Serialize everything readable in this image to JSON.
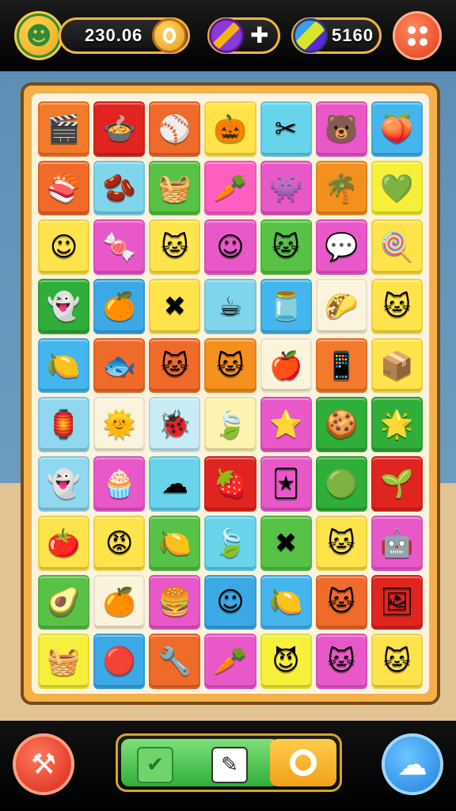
{
  "header": {
    "score": "230.06",
    "gems": "5160",
    "avatar_icon": "sun-face-icon",
    "score_icon": "coin-icon",
    "puzzle_icon": "puzzle-icon",
    "gem_icon": "gem-icon",
    "menu_icon": "dots-grid-icon"
  },
  "board": {
    "rows": [
      [
        {
          "icon": "clapperboard",
          "glyph": "🎬",
          "bg": "#f37a2a"
        },
        {
          "icon": "food-bowl",
          "glyph": "🍲",
          "bg": "#e0241f"
        },
        {
          "icon": "ball",
          "glyph": "⚾",
          "bg": "#f06a2a"
        },
        {
          "icon": "pumpkin",
          "glyph": "🎃",
          "bg": "#ffe34a"
        },
        {
          "icon": "crossed-sticks",
          "glyph": "✂",
          "bg": "#67d4ec"
        },
        {
          "icon": "bear-face",
          "glyph": "🐻",
          "bg": "#e958c8"
        },
        {
          "icon": "heart-fruit",
          "glyph": "🍑",
          "bg": "#45b5ee"
        }
      ],
      [
        {
          "icon": "sushi",
          "glyph": "🍣",
          "bg": "#f06a2a"
        },
        {
          "icon": "bean",
          "glyph": "🫘",
          "bg": "#7fd5ec"
        },
        {
          "icon": "basket",
          "glyph": "🧺",
          "bg": "#58c246"
        },
        {
          "icon": "carrot",
          "glyph": "🥕",
          "bg": "#ff5fc0"
        },
        {
          "icon": "monster-face",
          "glyph": "👾",
          "bg": "#e958c8"
        },
        {
          "icon": "palm",
          "glyph": "🌴",
          "bg": "#f4901e"
        },
        {
          "icon": "heart",
          "glyph": "💚",
          "bg": "#f6f03a"
        }
      ],
      [
        {
          "icon": "smile-face",
          "glyph": "☺",
          "bg": "#ffe34a"
        },
        {
          "icon": "candy",
          "glyph": "🍬",
          "bg": "#e958c8"
        },
        {
          "icon": "cat-face",
          "glyph": "🐱",
          "bg": "#ffe34a"
        },
        {
          "icon": "smile-face",
          "glyph": "☺",
          "bg": "#e958c8"
        },
        {
          "icon": "cat-face",
          "glyph": "🐱",
          "bg": "#58c246"
        },
        {
          "icon": "chat-face",
          "glyph": "💬",
          "bg": "#e958c8"
        },
        {
          "icon": "candy-ball",
          "glyph": "🍭",
          "bg": "#ffe34a"
        }
      ],
      [
        {
          "icon": "blob-face",
          "glyph": "👻",
          "bg": "#2fae3a"
        },
        {
          "icon": "orange-face",
          "glyph": "🍊",
          "bg": "#3aa9e6"
        },
        {
          "icon": "red-x",
          "glyph": "✖",
          "bg": "#ffe34a"
        },
        {
          "icon": "mug",
          "glyph": "☕",
          "bg": "#7fd5ec"
        },
        {
          "icon": "jar",
          "glyph": "🫙",
          "bg": "#45b5ee"
        },
        {
          "icon": "taco-face",
          "glyph": "🌮",
          "bg": "#fbf3dc"
        },
        {
          "icon": "cat-face",
          "glyph": "🐱",
          "bg": "#ffe34a"
        }
      ],
      [
        {
          "icon": "lemon-face",
          "glyph": "🍋",
          "bg": "#45b5ee"
        },
        {
          "icon": "fish-face",
          "glyph": "🐟",
          "bg": "#f06a2a"
        },
        {
          "icon": "cat-face",
          "glyph": "🐱",
          "bg": "#f06a2a"
        },
        {
          "icon": "cat-face",
          "glyph": "🐱",
          "bg": "#f4901e"
        },
        {
          "icon": "apple",
          "glyph": "🍎",
          "bg": "#fbf3dc"
        },
        {
          "icon": "tablet",
          "glyph": "📱",
          "bg": "#f37a2a"
        },
        {
          "icon": "box-face",
          "glyph": "📦",
          "bg": "#ffe34a"
        }
      ],
      [
        {
          "icon": "lantern",
          "glyph": "🏮",
          "bg": "#8fd8ee"
        },
        {
          "icon": "sun-face",
          "glyph": "🌞",
          "bg": "#fbf3dc"
        },
        {
          "icon": "bug-face",
          "glyph": "🐞",
          "bg": "#c7ecf4"
        },
        {
          "icon": "leaf",
          "glyph": "🍃",
          "bg": "#fdf3b0"
        },
        {
          "icon": "star-face",
          "glyph": "⭐",
          "bg": "#e958c8"
        },
        {
          "icon": "cookie-face",
          "glyph": "🍪",
          "bg": "#2fae3a"
        },
        {
          "icon": "spiky-face",
          "glyph": "🌟",
          "bg": "#2fae3a"
        }
      ],
      [
        {
          "icon": "ghost-face",
          "glyph": "👻",
          "bg": "#8fd8ee"
        },
        {
          "icon": "cupcake",
          "glyph": "🧁",
          "bg": "#e958c8"
        },
        {
          "icon": "cloud-face",
          "glyph": "☁",
          "bg": "#67d4ec"
        },
        {
          "icon": "strawberry",
          "glyph": "🍓",
          "bg": "#e0241f"
        },
        {
          "icon": "card",
          "glyph": "🃏",
          "bg": "#e958c8"
        },
        {
          "icon": "slime-face",
          "glyph": "🟢",
          "bg": "#2fae3a"
        },
        {
          "icon": "sprout-face",
          "glyph": "🌱",
          "bg": "#e0241f"
        }
      ],
      [
        {
          "icon": "tomato",
          "glyph": "🍅",
          "bg": "#ffe34a"
        },
        {
          "icon": "spiky-face",
          "glyph": "😡",
          "bg": "#ffe34a"
        },
        {
          "icon": "lemon-face",
          "glyph": "🍋",
          "bg": "#58c246"
        },
        {
          "icon": "leaf",
          "glyph": "🍃",
          "bg": "#67d4ec"
        },
        {
          "icon": "red-x",
          "glyph": "✖",
          "bg": "#58c246"
        },
        {
          "icon": "cat-face",
          "glyph": "🐱",
          "bg": "#ffe34a"
        },
        {
          "icon": "robot-face",
          "glyph": "🤖",
          "bg": "#e958c8"
        }
      ],
      [
        {
          "icon": "avocado-face",
          "glyph": "🥑",
          "bg": "#58c246"
        },
        {
          "icon": "orange",
          "glyph": "🍊",
          "bg": "#fbf3dc"
        },
        {
          "icon": "burger",
          "glyph": "🍔",
          "bg": "#e958c8"
        },
        {
          "icon": "smile-face",
          "glyph": "☺",
          "bg": "#3aa9e6"
        },
        {
          "icon": "lemon-face",
          "glyph": "🍋",
          "bg": "#45b5ee"
        },
        {
          "icon": "cat-face",
          "glyph": "🐱",
          "bg": "#f06a2a"
        },
        {
          "icon": "frame",
          "glyph": "🖼",
          "bg": "#e0241f"
        }
      ],
      [
        {
          "icon": "basket",
          "glyph": "🧺",
          "bg": "#f6f03a"
        },
        {
          "icon": "red-ball",
          "glyph": "🔴",
          "bg": "#3aa9e6"
        },
        {
          "icon": "tool",
          "glyph": "🔧",
          "bg": "#f06a2a"
        },
        {
          "icon": "carrot",
          "glyph": "🥕",
          "bg": "#e958c8"
        },
        {
          "icon": "devil-face",
          "glyph": "😈",
          "bg": "#f6f03a"
        },
        {
          "icon": "cat-face",
          "glyph": "🐱",
          "bg": "#e958c8"
        },
        {
          "icon": "cat-face",
          "glyph": "🐱",
          "bg": "#ffe34a"
        }
      ]
    ]
  },
  "footer": {
    "left_button_icon": "hammer-icon",
    "right_button_icon": "cloud-icon",
    "action_slots": [
      {
        "icon": "check-icon",
        "glyph": "✔"
      },
      {
        "icon": "notes-icon",
        "glyph": "✎"
      },
      {
        "icon": "ring-icon",
        "glyph": "◯"
      }
    ]
  }
}
